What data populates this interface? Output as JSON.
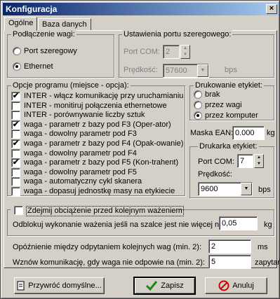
{
  "window": {
    "title": "Konfiguracja",
    "close_glyph": "×"
  },
  "tabs": [
    "Ogólne",
    "Baza danych"
  ],
  "scale_connection": {
    "legend": "Podłączenie wagi:",
    "options": [
      "Port szeregowy",
      "Ethernet"
    ],
    "selected": 1
  },
  "serial": {
    "legend": "Ustawienia portu szeregowego:",
    "port_label": "Port COM:",
    "port_value": "2",
    "speed_label": "Prędkość:",
    "speed_value": "57600",
    "speed_unit": "bps"
  },
  "program_options": {
    "legend": "Opcje programu (miejsce - opcja):",
    "items": [
      {
        "label": "INTER - włącz komunikację przy uruchamianiu",
        "checked": true
      },
      {
        "label": "INTER - monitiruj połączenia ethernetowe",
        "checked": false
      },
      {
        "label": "INTER - porównywanie liczby sztuk",
        "checked": false
      },
      {
        "label": "waga - parametr z bazy pod F3 (Oper-ator)",
        "checked": true
      },
      {
        "label": "waga - dowolny parametr pod F3",
        "checked": false
      },
      {
        "label": "waga - parametr z bazy pod F4 (Opak-owanie)",
        "checked": true
      },
      {
        "label": "waga - dowolny parametr pod F4",
        "checked": false
      },
      {
        "label": "waga - parametr z bazy pod F5 (Kon-trahent)",
        "checked": true
      },
      {
        "label": "waga - dowolny parametr pod F5",
        "checked": false
      },
      {
        "label": "waga - automatyczny cykl skanera",
        "checked": false
      },
      {
        "label": "waga - dopasuj jednostkę masy na etykiecie",
        "checked": false
      }
    ]
  },
  "label_printing": {
    "legend": "Drukowanie etykiet:",
    "options": [
      "brak",
      "przez wagi",
      "przez komputer"
    ],
    "selected": 2
  },
  "ean": {
    "label": "Maska EAN:",
    "value": "0.000",
    "unit": "kg"
  },
  "label_printer": {
    "legend": "Drukarka etykiet:",
    "port_label": "Port COM:",
    "port_value": "7",
    "speed_label": "Prędkość:",
    "speed_value": "9600",
    "speed_unit": "bps"
  },
  "tare": {
    "checkbox_label": "Zdejmij obciążenie przed kolejnym ważeniem",
    "checked": false,
    "text": "Odblokuj wykonanie ważenia jeśli na szalce jest nie więcej niż",
    "value": "0,05",
    "unit": "kg"
  },
  "delay": {
    "label": "Opóźnienie między odpytaniem kolejnych wag (min. 2):",
    "value": "2",
    "unit": "ms"
  },
  "retry": {
    "label": "Wznów komunikację, gdy waga nie odpowie na (min. 2):",
    "value": "5",
    "unit": "zapytań"
  },
  "buttons": {
    "restore": "Przywróć domyślne...",
    "ok": "Zapisz",
    "cancel": "Anuluj"
  },
  "check_glyph": "✔",
  "icons": {
    "restore": "document-icon",
    "ok": "green-checkmark-icon",
    "cancel": "red-stop-icon"
  },
  "colors": {
    "titlebar": "#0a246a",
    "ok_icon": "#1a8a1a",
    "cancel_icon": "#d40000"
  }
}
